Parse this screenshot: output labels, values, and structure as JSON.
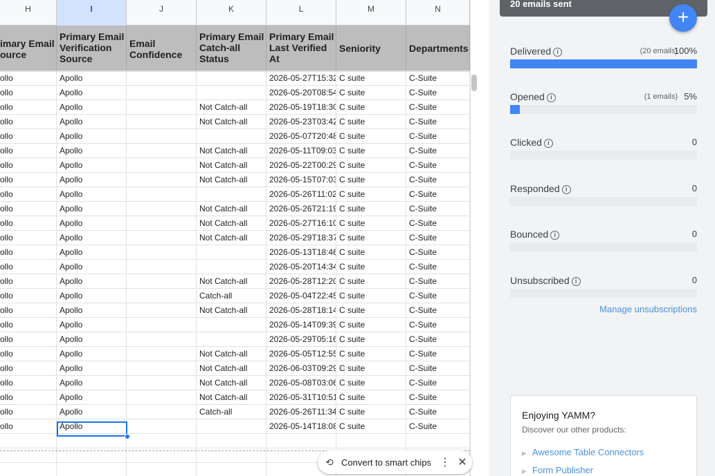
{
  "sheet": {
    "columns": [
      "H",
      "I",
      "J",
      "K",
      "L",
      "M",
      "N"
    ],
    "selected_column": "I",
    "headers": [
      "imary Email\nource",
      "Primary Email\nVerification\nSource",
      "Email\nConfidence",
      "Primary Email\nCatch-all\nStatus",
      "Primary Email\nLast Verified\nAt",
      "Seniority",
      "Departments"
    ],
    "rows": [
      [
        "ollo",
        "Apollo",
        "",
        "",
        "2026-05-27T15:32",
        "C suite",
        "C-Suite"
      ],
      [
        "ollo",
        "Apollo",
        "",
        "",
        "2026-05-20T08:54",
        "C suite",
        "C-Suite"
      ],
      [
        "ollo",
        "Apollo",
        "",
        "Not Catch-all",
        "2026-05-19T18:30",
        "C suite",
        "C-Suite"
      ],
      [
        "ollo",
        "Apollo",
        "",
        "Not Catch-all",
        "2026-05-23T03:42",
        "C suite",
        "C-Suite"
      ],
      [
        "ollo",
        "Apollo",
        "",
        "",
        "2026-05-07T20:48",
        "C suite",
        "C-Suite"
      ],
      [
        "ollo",
        "Apollo",
        "",
        "Not Catch-all",
        "2026-05-11T09:03",
        "C suite",
        "C-Suite"
      ],
      [
        "ollo",
        "Apollo",
        "",
        "Not Catch-all",
        "2026-05-22T00:29",
        "C suite",
        "C-Suite"
      ],
      [
        "ollo",
        "Apollo",
        "",
        "Not Catch-all",
        "2026-05-15T07:03",
        "C suite",
        "C-Suite"
      ],
      [
        "ollo",
        "Apollo",
        "",
        "",
        "2026-05-26T11:02",
        "C suite",
        "C-Suite"
      ],
      [
        "ollo",
        "Apollo",
        "",
        "Not Catch-all",
        "2026-05-26T21:19",
        "C suite",
        "C-Suite"
      ],
      [
        "ollo",
        "Apollo",
        "",
        "Not Catch-all",
        "2026-05-27T16:10",
        "C suite",
        "C-Suite"
      ],
      [
        "ollo",
        "Apollo",
        "",
        "Not Catch-all",
        "2026-05-29T18:37",
        "C suite",
        "C-Suite"
      ],
      [
        "ollo",
        "Apollo",
        "",
        "",
        "2026-05-13T18:46",
        "C suite",
        "C-Suite"
      ],
      [
        "ollo",
        "Apollo",
        "",
        "",
        "2026-05-20T14:34",
        "C suite",
        "C-Suite"
      ],
      [
        "ollo",
        "Apollo",
        "",
        "Not Catch-all",
        "2026-05-28T12:20",
        "C suite",
        "C-Suite"
      ],
      [
        "ollo",
        "Apollo",
        "",
        "Catch-all",
        "2026-05-04T22:45",
        "C suite",
        "C-Suite"
      ],
      [
        "ollo",
        "Apollo",
        "",
        "Not Catch-all",
        "2026-05-28T18:14",
        "C suite",
        "C-Suite"
      ],
      [
        "ollo",
        "Apollo",
        "",
        "",
        "2026-05-14T09:39",
        "C suite",
        "C-Suite"
      ],
      [
        "ollo",
        "Apollo",
        "",
        "",
        "2026-05-29T05:16",
        "C suite",
        "C-Suite"
      ],
      [
        "ollo",
        "Apollo",
        "",
        "Not Catch-all",
        "2026-05-05T12:55",
        "C suite",
        "C-Suite"
      ],
      [
        "ollo",
        "Apollo",
        "",
        "Not Catch-all",
        "2026-06-03T09:29",
        "C suite",
        "C-Suite"
      ],
      [
        "ollo",
        "Apollo",
        "",
        "Not Catch-all",
        "2026-05-08T03:06",
        "C suite",
        "C-Suite"
      ],
      [
        "ollo",
        "Apollo",
        "",
        "Not Catch-all",
        "2026-05-31T10:51",
        "C suite",
        "C-Suite"
      ],
      [
        "ollo",
        "Apollo",
        "",
        "Catch-all",
        "2026-05-26T11:34",
        "C suite",
        "C-Suite"
      ],
      [
        "ollo",
        "Apollo",
        "",
        "",
        "2026-05-14T18:08",
        "C suite",
        "C-Suite"
      ]
    ]
  },
  "toast": {
    "label": "Convert to smart chips",
    "icon": "smart-chip-icon"
  },
  "panel": {
    "header": "20 emails sent",
    "add_label": "+",
    "stats": [
      {
        "name": "Delivered",
        "count": "(20 emails)",
        "value": "100%",
        "fraction": 1.0
      },
      {
        "name": "Opened",
        "count": "(1 emails)",
        "value": "5%",
        "fraction": 0.05
      },
      {
        "name": "Clicked",
        "count": "",
        "value": "0",
        "fraction": 0
      },
      {
        "name": "Responded",
        "count": "",
        "value": "0",
        "fraction": 0
      },
      {
        "name": "Bounced",
        "count": "",
        "value": "0",
        "fraction": 0
      },
      {
        "name": "Unsubscribed",
        "count": "",
        "value": "0",
        "fraction": 0
      }
    ],
    "manage_link": "Manage unsubscriptions",
    "promo": {
      "title": "Enjoying YAMM?",
      "subtitle": "Discover our other products:",
      "links": [
        "Awesome Table Connectors",
        "Form Publisher"
      ]
    },
    "colors": {
      "accent": "#4285f4",
      "link": "#4a90e2",
      "header": "#5f6368"
    }
  }
}
